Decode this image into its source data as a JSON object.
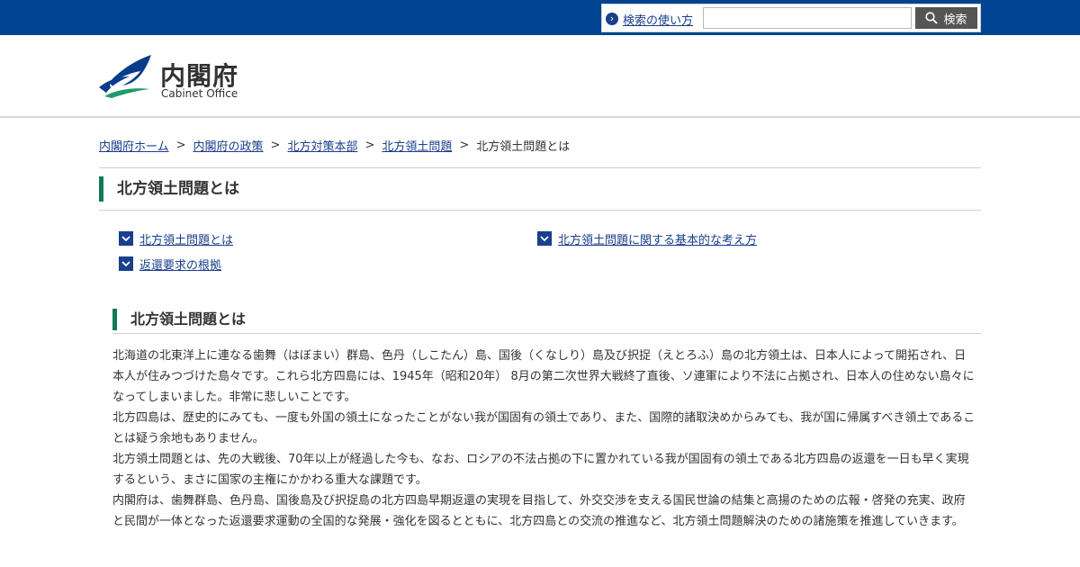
{
  "search": {
    "help_label": "検索の使い方",
    "input_value": "",
    "placeholder": "",
    "button_label": "検索"
  },
  "logo": {
    "name_jp": "内閣府",
    "name_en": "Cabinet Office"
  },
  "breadcrumb": [
    {
      "label": "内閣府ホーム",
      "link": true
    },
    {
      "label": "内閣府の政策",
      "link": true
    },
    {
      "label": "北方対策本部",
      "link": true
    },
    {
      "label": "北方領土問題",
      "link": true
    },
    {
      "label": "北方領土問題とは",
      "link": false
    }
  ],
  "page_title": "北方領土問題とは",
  "anchor_links": [
    {
      "label": "北方領土問題とは"
    },
    {
      "label": "北方領土問題に関する基本的な考え方"
    },
    {
      "label": "返還要求の根拠"
    }
  ],
  "section": {
    "title": "北方領土問題とは",
    "paragraphs": [
      "北海道の北東洋上に連なる歯舞（はぼまい）群島、色丹（しこたん）島、国後（くなしり）島及び択捉（えとろふ）島の北方領土は、日本人によって開拓され、日本人が住みつづけた島々です。これら北方四島には、1945年（昭和20年） 8月の第二次世界大戦終了直後、ソ連軍により不法に占拠され、日本人の住めない島々になってしまいました。非常に悲しいことです。",
      "北方四島は、歴史的にみても、一度も外国の領土になったことがない我が国固有の領土であり、また、国際的諸取決めからみても、我が国に帰属すべき領土であることは疑う余地もありません。",
      "北方領土問題とは、先の大戦後、70年以上が経過した今も、なお、ロシアの不法占拠の下に置かれている我が国固有の領土である北方四島の返還を一日も早く実現するという、まさに国家の主権にかかわる重大な課題です。",
      "内閣府は、歯舞群島、色丹島、国後島及び択捉島の北方四島早期返還の実現を目指して、外交交渉を支える国民世論の結集と高揚のための広報・啓発の充実、政府と民間が一体となった返還要求運動の全国的な発展・強化を図るとともに、北方四島との交流の推進など、北方領土問題解決のための諸施策を推進していきます。"
    ]
  },
  "colors": {
    "topbar": "#00438f",
    "link": "#1a3f8b",
    "accent_green": "#0f7a56",
    "search_button": "#555555"
  }
}
